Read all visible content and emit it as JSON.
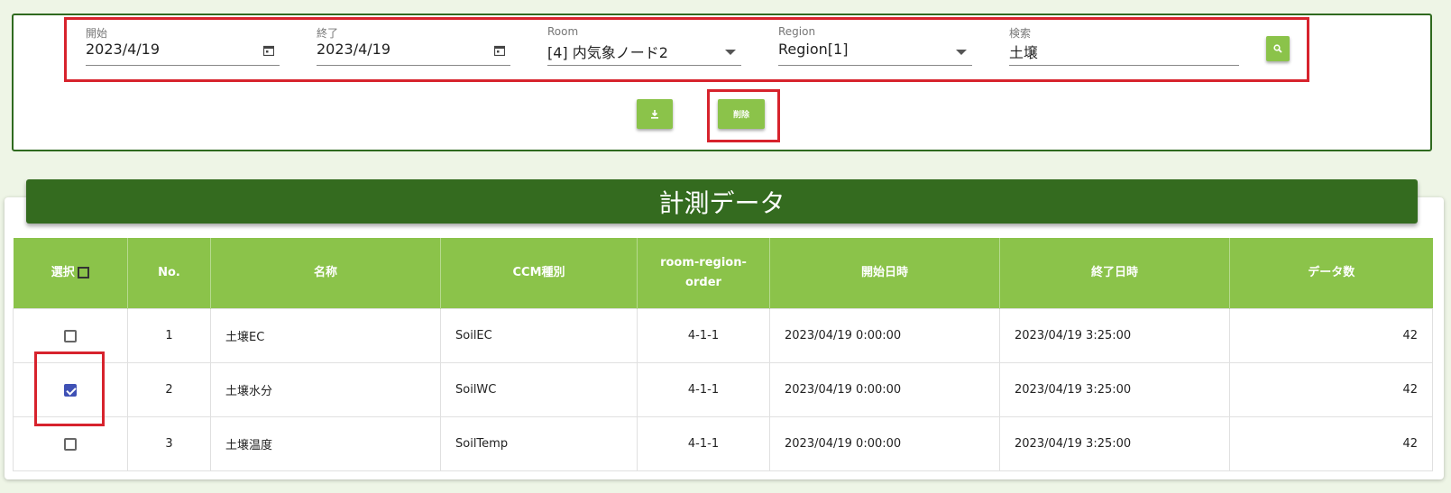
{
  "filters": {
    "start": {
      "label": "開始",
      "value": "2023/4/19"
    },
    "end": {
      "label": "終了",
      "value": "2023/4/19"
    },
    "room": {
      "label": "Room",
      "value": "[4] 内気象ノード2"
    },
    "region": {
      "label": "Region",
      "value": "Region[1]"
    },
    "search": {
      "label": "検索",
      "value": "土壌"
    }
  },
  "buttons": {
    "delete_label": "削除"
  },
  "table": {
    "title": "計測データ",
    "headers": {
      "select": "選択",
      "no": "No.",
      "name": "名称",
      "ccm": "CCM種別",
      "rro_line1": "room-region-",
      "rro_line2": "order",
      "start": "開始日時",
      "end": "終了日時",
      "count": "データ数"
    },
    "rows": [
      {
        "checked": false,
        "no": "1",
        "name": "土壌EC",
        "ccm": "SoilEC",
        "rro": "4-1-1",
        "start": "2023/04/19 0:00:00",
        "end": "2023/04/19 3:25:00",
        "count": "42"
      },
      {
        "checked": true,
        "no": "2",
        "name": "土壌水分",
        "ccm": "SoilWC",
        "rro": "4-1-1",
        "start": "2023/04/19 0:00:00",
        "end": "2023/04/19 3:25:00",
        "count": "42"
      },
      {
        "checked": false,
        "no": "3",
        "name": "土壌温度",
        "ccm": "SoilTemp",
        "rro": "4-1-1",
        "start": "2023/04/19 0:00:00",
        "end": "2023/04/19 3:25:00",
        "count": "42"
      }
    ]
  },
  "icons": {
    "calendar": "calendar-icon",
    "dropdown": "chevron-down-icon",
    "search": "search-icon",
    "download": "download-icon"
  },
  "colors": {
    "accent": "#8bc34a",
    "banner": "#346b1f",
    "highlight": "#d7232d",
    "checkbox": "#3f51b5"
  }
}
